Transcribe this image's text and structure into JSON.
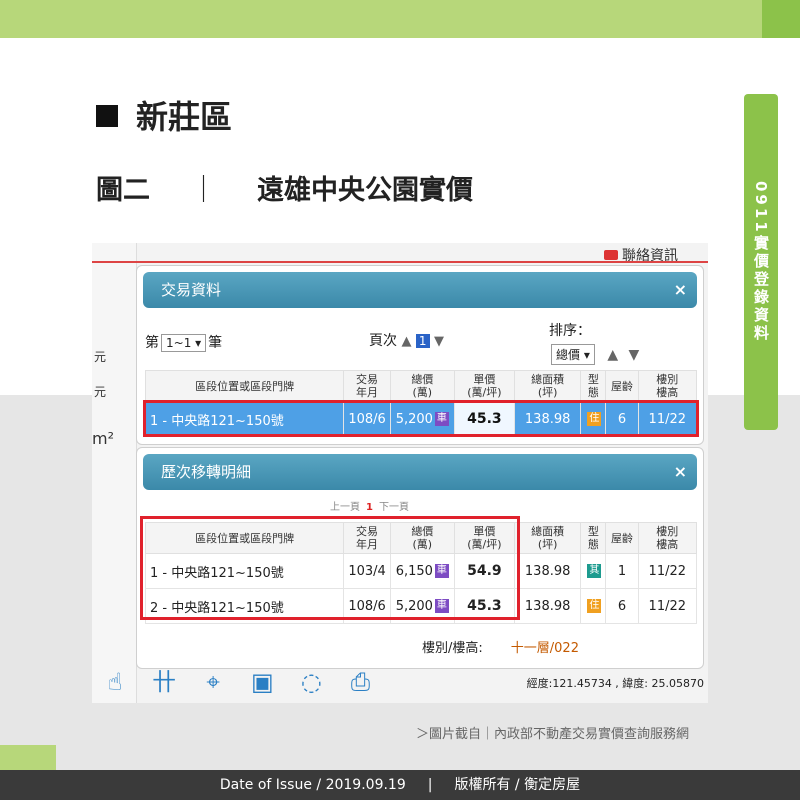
{
  "side_tab": "0911實價登錄資料",
  "section_title": "新莊區",
  "figure": {
    "label": "圖二",
    "separator": "｜",
    "title": "遠雄中央公園實價"
  },
  "contact_label": "聯絡資訊",
  "map_left": {
    "unit1": "元",
    "unit2": "元",
    "area_unit": "m²"
  },
  "panel1": {
    "title": "交易資料",
    "close": "×",
    "count_prefix": "第",
    "count_select": "1~1",
    "count_suffix": "筆",
    "page_label": "頁次",
    "page_up": "▲",
    "page_current": "1",
    "page_down": "▼",
    "sort_label": "排序：",
    "sort_select": "總價",
    "sort_up": "▲",
    "sort_down": "▼",
    "headers": [
      "區段位置或區段門牌",
      "交易\n年月",
      "總價\n(萬)",
      "單價\n(萬/坪)",
      "總面積\n(坪)",
      "型\n態",
      "屋齡",
      "樓別\n樓高"
    ],
    "rows": [
      {
        "addr": "1 - 中央路121~150號",
        "date": "108/6",
        "total": "5,200",
        "total_badge": "車",
        "unit": "45.3",
        "area": "138.98",
        "type": "住",
        "age": "6",
        "floor": "11/22"
      }
    ]
  },
  "panel2": {
    "title": "歷次移轉明細",
    "close": "×",
    "pager_prev": "上一頁",
    "pager_cur": "1",
    "pager_next": "下一頁",
    "headers": [
      "區段位置或區段門牌",
      "交易\n年月",
      "總價\n(萬)",
      "單價\n(萬/坪)",
      "總面積\n(坪)",
      "型\n態",
      "屋齡",
      "樓別\n樓高"
    ],
    "rows": [
      {
        "addr": "1 - 中央路121~150號",
        "date": "103/4",
        "total": "6,150",
        "total_badge": "車",
        "unit": "54.9",
        "area": "138.98",
        "type": "其",
        "age": "1",
        "floor": "11/22"
      },
      {
        "addr": "2 - 中央路121~150號",
        "date": "108/6",
        "total": "5,200",
        "total_badge": "車",
        "unit": "45.3",
        "area": "138.98",
        "type": "住",
        "age": "6",
        "floor": "11/22"
      }
    ],
    "floor_label": "樓別/樓高:",
    "floor_value": "十一層/022"
  },
  "coords": "經度:121.45734 , 緯度: 25.05870",
  "credit": "＞圖片截自｜內政部不動產交易實價查詢服務網",
  "footer": {
    "date": "Date of Issue / 2019.09.19",
    "sep": "|",
    "copyright": "版權所有 / 衡定房屋"
  }
}
